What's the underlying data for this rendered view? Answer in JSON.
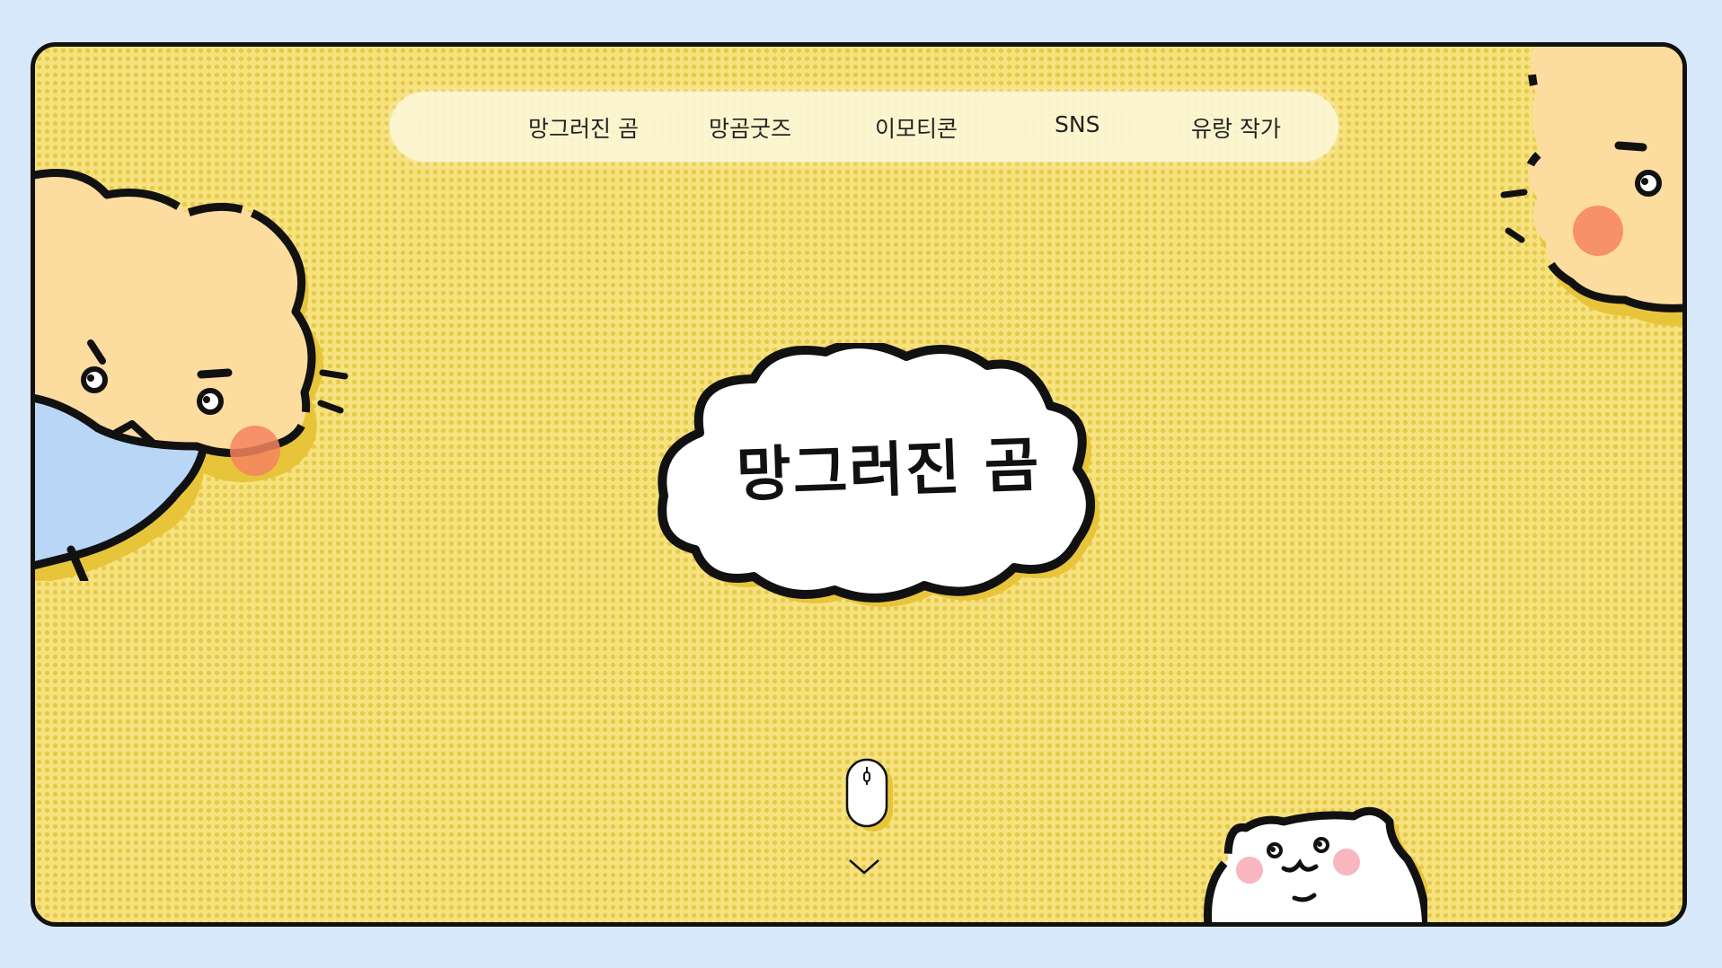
{
  "nav": {
    "items": [
      {
        "label": "망그러진 곰"
      },
      {
        "label": "망곰굿즈"
      },
      {
        "label": "이모티콘"
      },
      {
        "label": "SNS"
      },
      {
        "label": "유랑 작가"
      }
    ]
  },
  "hero": {
    "logo_text": "망그러진 곰"
  },
  "colors": {
    "page_bg": "#d8e8fb",
    "frame_bg": "#f6e27e",
    "dot": "#e7c94c",
    "bear_face": "#fddca0",
    "blush": "#f4845f",
    "shirt": "#b9d6f7",
    "outline": "#111111"
  },
  "icons": [
    "mouse-scroll-icon",
    "chevron-down-icon"
  ]
}
